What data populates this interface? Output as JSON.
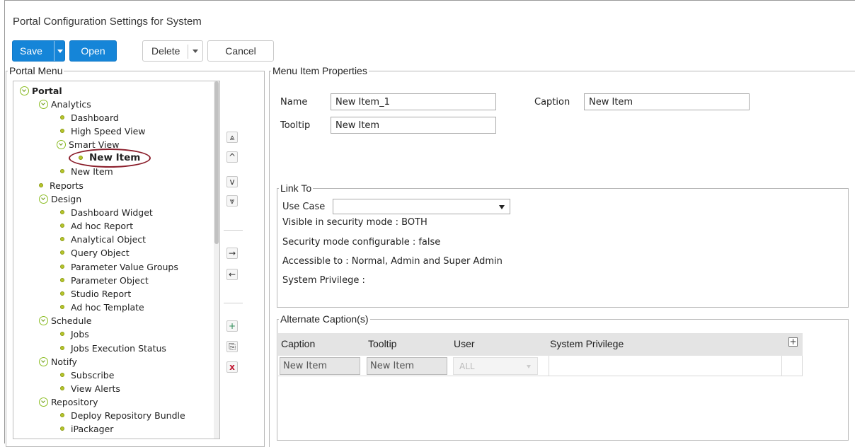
{
  "window": {
    "title": "Portal Configuration Settings for System"
  },
  "toolbar": {
    "save": "Save",
    "open": "Open",
    "delete": "Delete",
    "cancel": "Cancel"
  },
  "portal_menu": {
    "legend": "Portal Menu",
    "tree": {
      "portal": "Portal",
      "analytics": "Analytics",
      "dashboard": "Dashboard",
      "high_speed_view": "High Speed View",
      "smart_view": "Smart View",
      "new_item_selected": "New Item",
      "new_item": "New Item",
      "reports": "Reports",
      "design": "Design",
      "dashboard_widget": "Dashboard Widget",
      "ad_hoc_report": "Ad hoc Report",
      "analytical_object": "Analytical Object",
      "query_object": "Query Object",
      "parameter_value_groups": "Parameter Value Groups",
      "parameter_object": "Parameter Object",
      "studio_report": "Studio Report",
      "ad_hoc_template": "Ad hoc Template",
      "schedule": "Schedule",
      "jobs": "Jobs",
      "jobs_execution_status": "Jobs Execution Status",
      "notify": "Notify",
      "subscribe": "Subscribe",
      "view_alerts": "View Alerts",
      "repository": "Repository",
      "deploy_repository_bundle": "Deploy Repository Bundle",
      "ipackager": "iPackager"
    },
    "icons": {
      "move_top": "⩓",
      "move_up": "^",
      "move_down": "v",
      "move_bottom": "⩔",
      "indent": "→",
      "outdent": "←",
      "add": "+",
      "copy": "⎘",
      "delete": "x"
    }
  },
  "properties": {
    "legend": "Menu Item Properties",
    "name_label": "Name",
    "name_value": "New Item_1",
    "caption_label": "Caption",
    "caption_value": "New Item",
    "tooltip_label": "Tooltip",
    "tooltip_value": "New Item"
  },
  "link_to": {
    "legend": "Link To",
    "use_case_label": "Use Case",
    "use_case_value": "",
    "visible_mode": "Visible in security mode : BOTH",
    "security_configurable": "Security mode configurable : false",
    "accessible_to": "Accessible to : Normal, Admin and Super Admin",
    "system_privilege": "System Privilege :"
  },
  "alternate_captions": {
    "legend": "Alternate Caption(s)",
    "columns": [
      "Caption",
      "Tooltip",
      "User",
      "System Privilege"
    ],
    "add_icon": "+",
    "row": {
      "caption": "New Item",
      "tooltip": "New Item",
      "user": "ALL"
    }
  },
  "colors": {
    "primary": "#1585d8",
    "tree_icon": "#8bbd22",
    "highlight": "#8b1e2b"
  }
}
